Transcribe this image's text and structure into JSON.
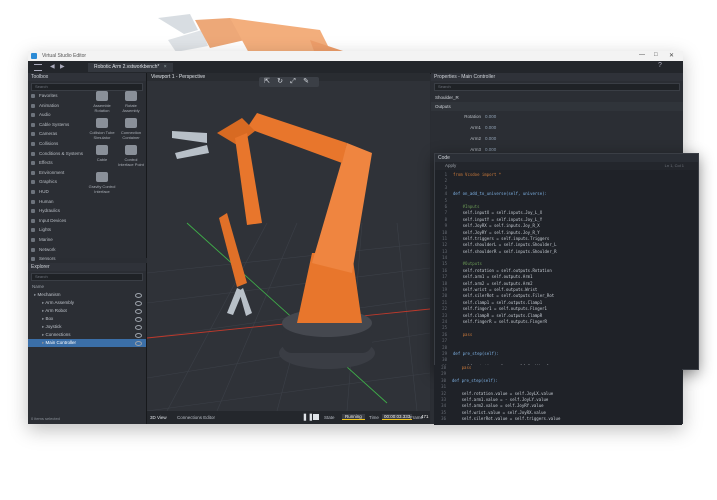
{
  "window": {
    "title": "Virtual Studio Editor",
    "controls": [
      "—",
      "□",
      "✕"
    ]
  },
  "tabs": [
    {
      "label": "Robotic Arm 2.vstworkbench*"
    }
  ],
  "toolbox": {
    "header": "Toolbox",
    "search_placeholder": "Search",
    "categories": [
      "Favorites",
      "Animation",
      "Audio",
      "Cable Systems",
      "Cameras",
      "Collisions",
      "Conditions & Systems",
      "Effects",
      "Environment",
      "Graphics",
      "HUD",
      "Human",
      "Hydraulics",
      "Input Devices",
      "Lights",
      "Marine",
      "Network",
      "Sensors"
    ],
    "tiles": [
      "Assemble Rotation",
      "Rotate Assembly",
      "Collision Tube Simulator",
      "Connection Container",
      "Cable",
      "Control Interface Point",
      "Gravity Control Interface"
    ]
  },
  "explorer": {
    "header": "Explorer",
    "search_placeholder": "Search",
    "column": "Name",
    "items": [
      {
        "label": "Mechanism",
        "indent": 0,
        "selected": false
      },
      {
        "label": "Arm Assembly",
        "indent": 1,
        "selected": false
      },
      {
        "label": "Arm Robot",
        "indent": 1,
        "selected": false
      },
      {
        "label": "Box",
        "indent": 1,
        "selected": false
      },
      {
        "label": "Joystick",
        "indent": 1,
        "selected": false
      },
      {
        "label": "Connections",
        "indent": 1,
        "selected": false
      },
      {
        "label": "Main Controller",
        "indent": 1,
        "selected": true
      }
    ],
    "footer": "0 items selected"
  },
  "viewport": {
    "title": "Viewport 1 - Perspective",
    "tools": [
      "⇱",
      "↻",
      "⤢",
      "✎"
    ]
  },
  "status": {
    "tab1": "3D View",
    "tab2": "Connections Editor",
    "state_label": "State",
    "state": "Running",
    "time_label": "Time",
    "time": "00:00:03.333",
    "frame_label": "Frame",
    "frame": "471"
  },
  "properties": {
    "header": "Properties - Main Controller",
    "search_placeholder": "Search",
    "field": "Shoulder_R",
    "section": "Outputs",
    "rows": [
      {
        "name": "Rotation",
        "value": "0.000"
      },
      {
        "name": "Arm1",
        "value": "0.000"
      },
      {
        "name": "Arm2",
        "value": "0.000"
      },
      {
        "name": "Arm3",
        "value": "0.000"
      },
      {
        "name": "Wrist",
        "value": "0.000"
      }
    ]
  },
  "code": {
    "header": "Code",
    "apply": "Apply",
    "ln_col": "Ln 1, Col 1",
    "lines": [
      {
        "n": "1",
        "t": "from Vcsdoe import *",
        "c": "kw"
      },
      {
        "n": "2",
        "t": "",
        "c": "tx"
      },
      {
        "n": "3",
        "t": "",
        "c": "tx"
      },
      {
        "n": "4",
        "t": "def on_add_to_universe(self, universe):",
        "c": "fn"
      },
      {
        "n": "5",
        "t": "",
        "c": "tx"
      },
      {
        "n": "6",
        "t": "    #Inputs",
        "c": "cm"
      },
      {
        "n": "7",
        "t": "    self.inputX = self.inputs.Joy_L_X",
        "c": "tx"
      },
      {
        "n": "8",
        "t": "    self.inputY = self.inputs.Joy_L_Y",
        "c": "tx"
      },
      {
        "n": "9",
        "t": "    self.JoyRX = self.inputs.Joy_R_X",
        "c": "tx"
      },
      {
        "n": "10",
        "t": "    self.JoyRY = self.inputs.Joy_R_Y",
        "c": "tx"
      },
      {
        "n": "11",
        "t": "    self.triggers = self.inputs.Triggers",
        "c": "tx"
      },
      {
        "n": "12",
        "t": "    self.shoulderL = self.inputs.Shoulder_L",
        "c": "tx"
      },
      {
        "n": "13",
        "t": "    self.shoulderR = self.inputs.Shoulder_R",
        "c": "tx"
      },
      {
        "n": "14",
        "t": "",
        "c": "tx"
      },
      {
        "n": "15",
        "t": "    #Outputs",
        "c": "cm"
      },
      {
        "n": "16",
        "t": "    self.rotation = self.outputs.Rotation",
        "c": "tx"
      },
      {
        "n": "17",
        "t": "    self.arm1 = self.outputs.Arm1",
        "c": "tx"
      },
      {
        "n": "18",
        "t": "    self.arm2 = self.outputs.Arm2",
        "c": "tx"
      },
      {
        "n": "19",
        "t": "    self.wrist = self.outputs.Wrist",
        "c": "tx"
      },
      {
        "n": "20",
        "t": "    self.silerRot = self.outputs.Filer_Rot",
        "c": "tx"
      },
      {
        "n": "21",
        "t": "    self.clamp1 = self.outputs.Clamp1",
        "c": "tx"
      },
      {
        "n": "22",
        "t": "    self.finger1 = self.outputs.Finger1",
        "c": "tx"
      },
      {
        "n": "23",
        "t": "    self.clampR = self.outputs.ClampR",
        "c": "tx"
      },
      {
        "n": "24",
        "t": "    self.fingerR = self.outputs.FingerR",
        "c": "tx"
      },
      {
        "n": "25",
        "t": "",
        "c": "tx"
      },
      {
        "n": "26",
        "t": "    pass",
        "c": "kw"
      },
      {
        "n": "27",
        "t": "",
        "c": "tx"
      },
      {
        "n": "28",
        "t": "",
        "c": "tx"
      },
      {
        "n": "29",
        "t": "def pre_step(self):",
        "c": "fn"
      },
      {
        "n": "30",
        "t": "",
        "c": "tx"
      },
      {
        "n": "31",
        "t": "    self.rotation.value = self.JoyLX.value",
        "c": "tx"
      },
      {
        "n": "32",
        "t": "    self.arm1.value = - self.JoyLY.value",
        "c": "tx"
      },
      {
        "n": "33",
        "t": "    self.arm2.value = self.JoyRY.value",
        "c": "tx"
      },
      {
        "n": "34",
        "t": "    self.wrist.value = self.JoyRX.value",
        "c": "tx"
      },
      {
        "n": "35",
        "t": "    self.silerRot.value = self.triggers.value",
        "c": "tx"
      }
    ],
    "lower_lines": [
      {
        "n": "28",
        "t": "    pass",
        "c": "kw"
      },
      {
        "n": "29",
        "t": "",
        "c": "tx"
      },
      {
        "n": "30",
        "t": "def pre_step(self):",
        "c": "fn"
      },
      {
        "n": "31",
        "t": "",
        "c": "tx"
      },
      {
        "n": "32",
        "t": "    self.rotation.value = self.JoyLX.value",
        "c": "tx"
      },
      {
        "n": "33",
        "t": "    self.arm1.value = - self.JoyLY.value",
        "c": "tx"
      },
      {
        "n": "34",
        "t": "    self.arm2.value = self.JoyRY.value",
        "c": "tx"
      },
      {
        "n": "35",
        "t": "    self.wrist.value = self.JoyRX.value",
        "c": "tx"
      },
      {
        "n": "36",
        "t": "    self.silerRot.value = self.triggers.value",
        "c": "tx"
      }
    ]
  },
  "colors": {
    "accent": "#e8762c",
    "selection": "#3b6fa8",
    "grid_x": "#c0392b",
    "grid_z": "#3fae49"
  }
}
